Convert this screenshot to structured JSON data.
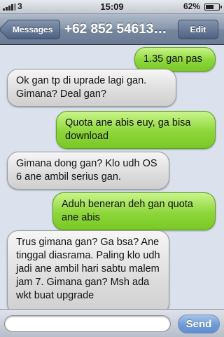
{
  "status_bar": {
    "carrier": "3",
    "time": "15:09",
    "battery_percent": "62%",
    "battery_level": 0.62,
    "signal_bars": 5
  },
  "nav": {
    "back_label": "Messages",
    "title": "+62 852 54613…",
    "edit_label": "Edit"
  },
  "messages": [
    {
      "direction": "out",
      "text": "1.35 gan pas"
    },
    {
      "direction": "in",
      "text": "Ok gan tp di uprade lagi gan. Gimana? Deal gan?"
    },
    {
      "direction": "out",
      "text": "Quota ane abis euy, ga bisa download"
    },
    {
      "direction": "in",
      "text": "Gimana dong gan? Klo udh OS 6 ane ambil serius gan."
    },
    {
      "direction": "out",
      "text": "Aduh beneran deh gan quota ane abis"
    },
    {
      "direction": "in",
      "text": "Trus gimana gan? Ga bsa? Ane tinggal diasrama. Paling klo udh jadi ane ambil hari sabtu malem jam 7. Gimana gan? Msh ada wkt buat upgrade"
    }
  ],
  "compose": {
    "input_value": "",
    "send_label": "Send"
  },
  "colors": {
    "outgoing_bubble": "#8dd63a",
    "incoming_bubble": "#dcdcdc",
    "navbar": "#7887a0",
    "send_button": "#6f9bd8"
  }
}
